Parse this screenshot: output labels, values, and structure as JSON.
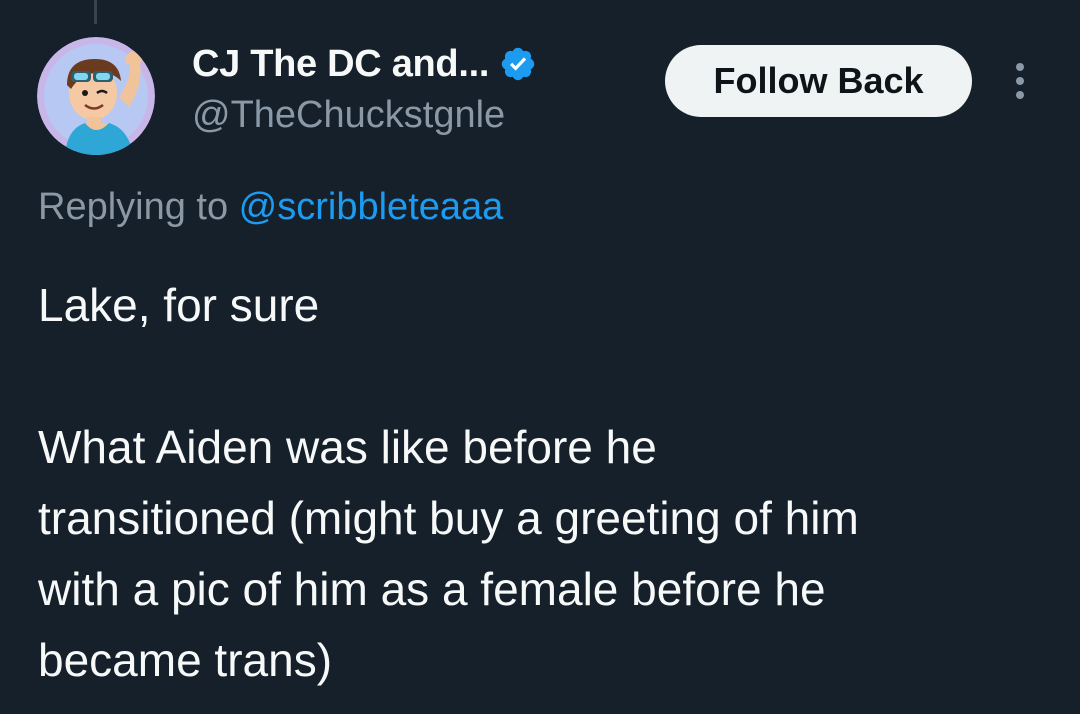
{
  "tweet": {
    "author": {
      "display_name": "CJ The DC and...",
      "handle": "@TheChuckstgnle",
      "verified": true,
      "avatar_icon": "cartoon-avatar"
    },
    "follow_button_label": "Follow Back",
    "more_icon": "more-vertical-icon",
    "replying_to": {
      "prefix": "Replying to",
      "mention": "@scribbleteaaa"
    },
    "text_lines": [
      "Lake, for sure",
      "What Aiden was like before he",
      "transitioned (might buy a greeting of him",
      "with a pic of him as a female before he",
      "became trans)"
    ]
  },
  "colors": {
    "background": "#15202b",
    "primary_text": "#f7f9f9",
    "secondary_text": "#8b98a5",
    "link": "#1d9bf0",
    "verified_badge": "#1d9bf0",
    "button_bg": "#eff3f4",
    "button_text": "#0f1419"
  }
}
